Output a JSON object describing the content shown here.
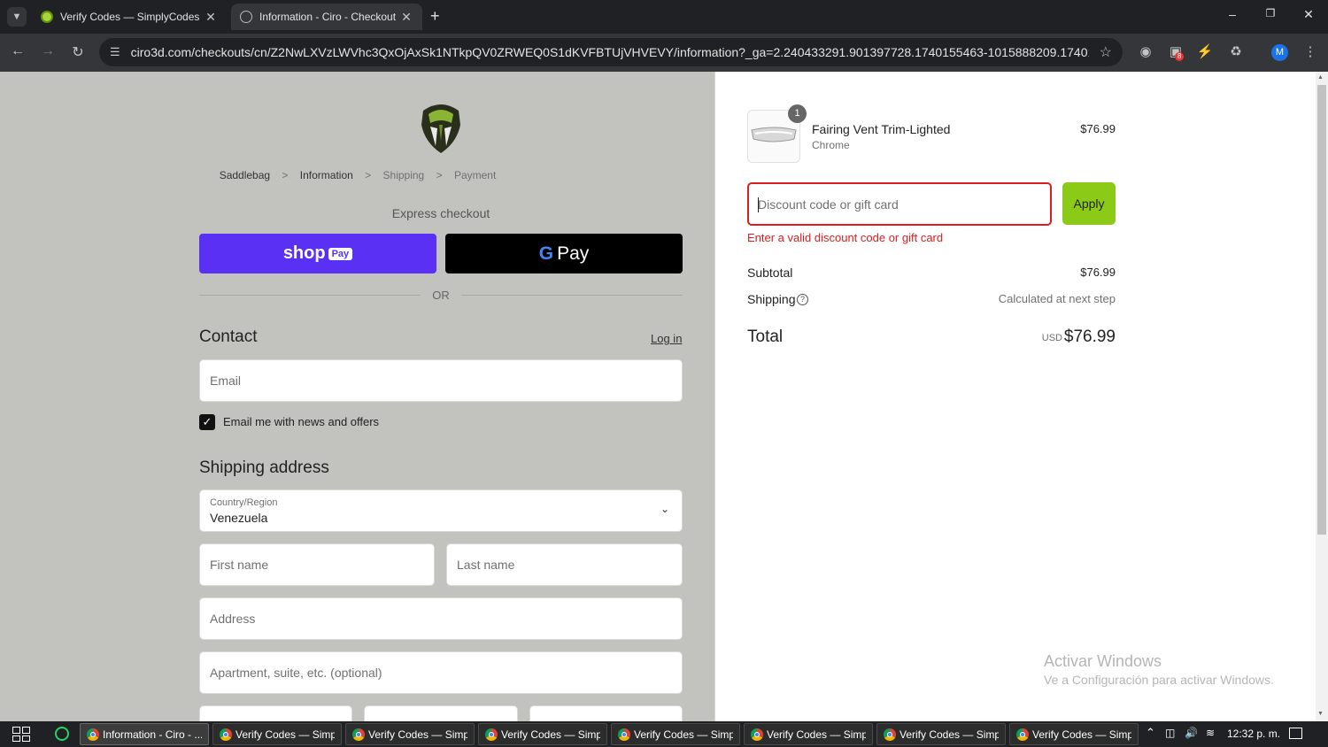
{
  "browser": {
    "tabs": [
      {
        "title": "Verify Codes — SimplyCodes",
        "active": false,
        "favicon": "simplycodes-icon"
      },
      {
        "title": "Information - Ciro - Checkout",
        "active": true,
        "favicon": "globe-icon"
      }
    ],
    "new_tab_label": "+",
    "url": "ciro3d.com/checkouts/cn/Z2NwLXVzLWVhc3QxOjAxSk1NTkpQV0ZRWEQ0S1dKVFBTUjVHVEVY/information?_ga=2.240433291.901397728.1740155463-1015888209.1740155463&auto_r...",
    "profile_initial": "M",
    "extension_badge": "8"
  },
  "checkout": {
    "breadcrumb": {
      "items": [
        "Saddlebag",
        "Information",
        "Shipping",
        "Payment"
      ],
      "separator": ">"
    },
    "express_checkout_label": "Express checkout",
    "shop_pay": {
      "shop": "shop",
      "pay": "Pay"
    },
    "gpay": {
      "g": "G",
      "pay": "Pay"
    },
    "or_label": "OR",
    "contact": {
      "heading": "Contact",
      "login_link": "Log in",
      "email_placeholder": "Email",
      "newsletter_label": "Email me with news and offers",
      "newsletter_checked": true
    },
    "shipping": {
      "heading": "Shipping address",
      "country_label": "Country/Region",
      "country_value": "Venezuela",
      "first_name_placeholder": "First name",
      "last_name_placeholder": "Last name",
      "address_placeholder": "Address",
      "apartment_placeholder": "Apartment, suite, etc. (optional)"
    }
  },
  "summary": {
    "item": {
      "name": "Fairing Vent Trim-Lighted",
      "variant": "Chrome",
      "price": "$76.99",
      "quantity": "1"
    },
    "discount_placeholder": "Discount code or gift card",
    "apply_label": "Apply",
    "error_message": "Enter a valid discount code or gift card",
    "subtotal_label": "Subtotal",
    "subtotal_value": "$76.99",
    "shipping_label": "Shipping",
    "shipping_value": "Calculated at next step",
    "total_label": "Total",
    "currency": "USD",
    "total_value": "$76.99"
  },
  "watermark": {
    "title": "Activar Windows",
    "subtitle": "Ve a Configuración para activar Windows."
  },
  "taskbar": {
    "items": [
      "Information - Ciro - ...",
      "Verify Codes — Simp...",
      "Verify Codes — Simp...",
      "Verify Codes — Simp...",
      "Verify Codes — Simp...",
      "Verify Codes — Simp...",
      "Verify Codes — Simp...",
      "Verify Codes — Simp..."
    ],
    "clock": "12:32 p. m."
  },
  "colors": {
    "shop_pay": "#5a31f4",
    "apply_button": "#8bcb17",
    "error": "#dd1d1d",
    "left_panel_bg": "#c2c2bf"
  }
}
